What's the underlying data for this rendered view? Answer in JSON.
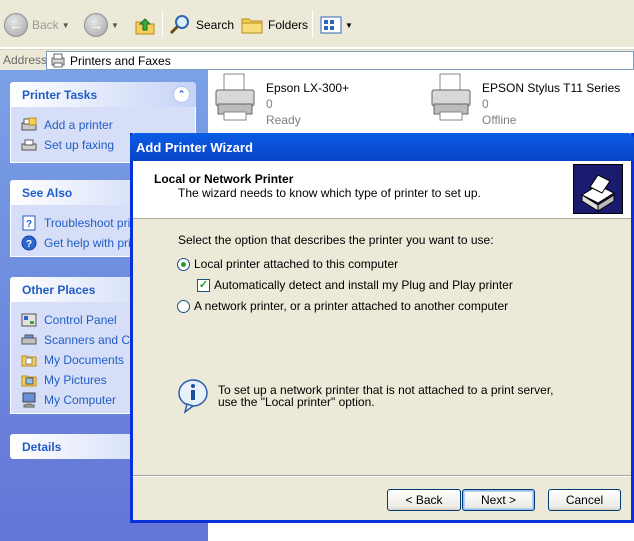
{
  "toolbar": {
    "back_label": "Back",
    "search_label": "Search",
    "folders_label": "Folders"
  },
  "address": {
    "label": "Address",
    "value": "Printers and Faxes"
  },
  "taskpane": {
    "printer_tasks": {
      "title": "Printer Tasks",
      "items": [
        {
          "label": "Add a printer",
          "icon": "add-printer-icon"
        },
        {
          "label": "Set up faxing",
          "icon": "fax-icon"
        }
      ]
    },
    "see_also": {
      "title": "See Also",
      "items": [
        {
          "label": "Troubleshoot prin",
          "icon": "help-book-icon"
        },
        {
          "label": "Get help with prin",
          "icon": "help-icon"
        }
      ]
    },
    "other_places": {
      "title": "Other Places",
      "items": [
        {
          "label": "Control Panel",
          "icon": "control-panel-icon"
        },
        {
          "label": "Scanners and Car",
          "icon": "scanner-icon"
        },
        {
          "label": "My Documents",
          "icon": "documents-folder-icon"
        },
        {
          "label": "My Pictures",
          "icon": "pictures-folder-icon"
        },
        {
          "label": "My Computer",
          "icon": "computer-icon"
        }
      ]
    },
    "details": {
      "title": "Details"
    }
  },
  "printers": [
    {
      "name": "Epson LX-300+",
      "docs": "0",
      "status": "Ready"
    },
    {
      "name": "EPSON Stylus T11 Series",
      "docs": "0",
      "status": "Offline"
    }
  ],
  "wizard": {
    "title": "Add Printer Wizard",
    "heading": "Local or Network Printer",
    "subheading": "The wizard needs to know which type of printer to set up.",
    "prompt": "Select the option that describes the printer you want to use:",
    "option_local": "Local printer attached to this computer",
    "option_local_selected": true,
    "option_autodetect": "Automatically detect and install my Plug and Play printer",
    "option_autodetect_checked": true,
    "option_network": "A network printer, or a printer attached to another computer",
    "info_line1": "To set up a network printer that is not attached to a print server,",
    "info_line2": "use the \"Local printer\" option.",
    "back_label": "< Back",
    "next_label": "Next >",
    "cancel_label": "Cancel"
  },
  "colors": {
    "xp_blue_title": "#0a5fe5",
    "task_link": "#215dc6",
    "dialog_face": "#ece9d8"
  }
}
